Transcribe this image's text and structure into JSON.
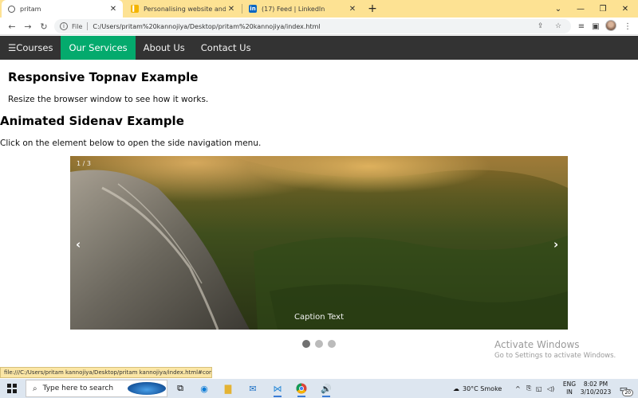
{
  "browser": {
    "tabs": [
      {
        "title": "pritam",
        "favicon": "globe-icon",
        "active": true
      },
      {
        "title": "Personalising website and under",
        "favicon": "slides-icon",
        "active": false
      },
      {
        "title": "(17) Feed | LinkedIn",
        "favicon": "linkedin-icon",
        "active": false
      }
    ],
    "new_tab_label": "+",
    "address": {
      "scheme_label": "File",
      "url": "C:/Users/pritam%20kannojiya/Desktop/pritam%20kannojiya/index.html"
    },
    "status_url": "file:///C:/Users/pritam kannojiya/Desktop/pritam kannojiya/index.html#cont..."
  },
  "page": {
    "nav": [
      {
        "label": "☰Courses",
        "active": false
      },
      {
        "label": "Our Services",
        "active": true
      },
      {
        "label": "About Us",
        "active": false
      },
      {
        "label": "Contact Us",
        "active": false
      }
    ],
    "heading1": "Responsive Topnav Example",
    "text1": "Resize the browser window to see how it works.",
    "heading2": "Animated Sidenav Example",
    "text2": "Click on the element below to open the side navigation menu.",
    "slideshow": {
      "number_text": "1 / 3",
      "caption": "Caption Text",
      "prev_label": "‹",
      "next_label": "›",
      "dots": [
        true,
        false,
        false
      ]
    }
  },
  "watermark": {
    "line1": "Activate Windows",
    "line2": "Go to Settings to activate Windows."
  },
  "taskbar": {
    "search_placeholder": "Type here to search",
    "weather": "30°C  Smoke",
    "lang_line1": "ENG",
    "lang_line2": "IN",
    "time": "8:02 PM",
    "date": "3/10/2023",
    "notification_count": "20"
  },
  "colors": {
    "tabstrip": "#fde293",
    "topnav_bg": "#333333",
    "active_nav": "#04aa6d",
    "taskbar": "#dde6f0"
  }
}
